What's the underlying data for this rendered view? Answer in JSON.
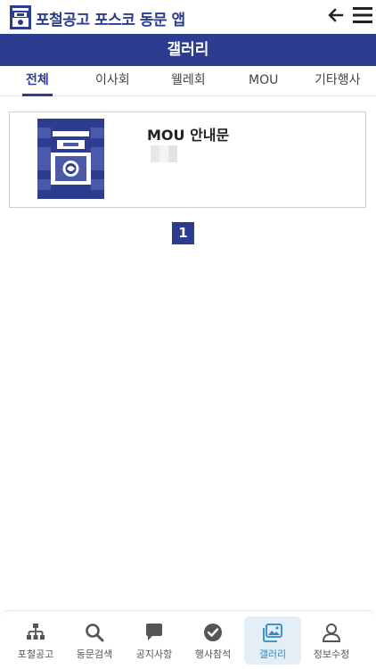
{
  "app": {
    "title": "포철공고 포스코 동문 앱",
    "logo_icon": "school-logo-icon",
    "back_icon": "arrow-left-icon",
    "menu_icon": "hamburger-menu-icon"
  },
  "page": {
    "title": "갤러리"
  },
  "tabs": [
    {
      "label": "전체",
      "active": true
    },
    {
      "label": "이사회",
      "active": false
    },
    {
      "label": "웰레회",
      "active": false
    },
    {
      "label": "MOU",
      "active": false
    },
    {
      "label": "기타행사",
      "active": false
    }
  ],
  "gallery": {
    "items": [
      {
        "title": "MOU 안내문",
        "thumbnail_icon": "school-emblem-icon"
      }
    ]
  },
  "pagination": {
    "current": "1"
  },
  "bottom_nav": [
    {
      "label": "포철공고",
      "icon": "org-chart-icon",
      "active": false
    },
    {
      "label": "동문검색",
      "icon": "search-icon",
      "active": false
    },
    {
      "label": "공지사항",
      "icon": "chat-bubble-icon",
      "active": false
    },
    {
      "label": "행사참석",
      "icon": "check-circle-icon",
      "active": false
    },
    {
      "label": "갤러리",
      "icon": "gallery-icon",
      "active": true
    },
    {
      "label": "정보수정",
      "icon": "person-icon",
      "active": false
    }
  ],
  "colors": {
    "brand": "#2c3d8f",
    "nav_active_bg": "#e4eef6",
    "nav_active_text": "#2c8bc6"
  }
}
